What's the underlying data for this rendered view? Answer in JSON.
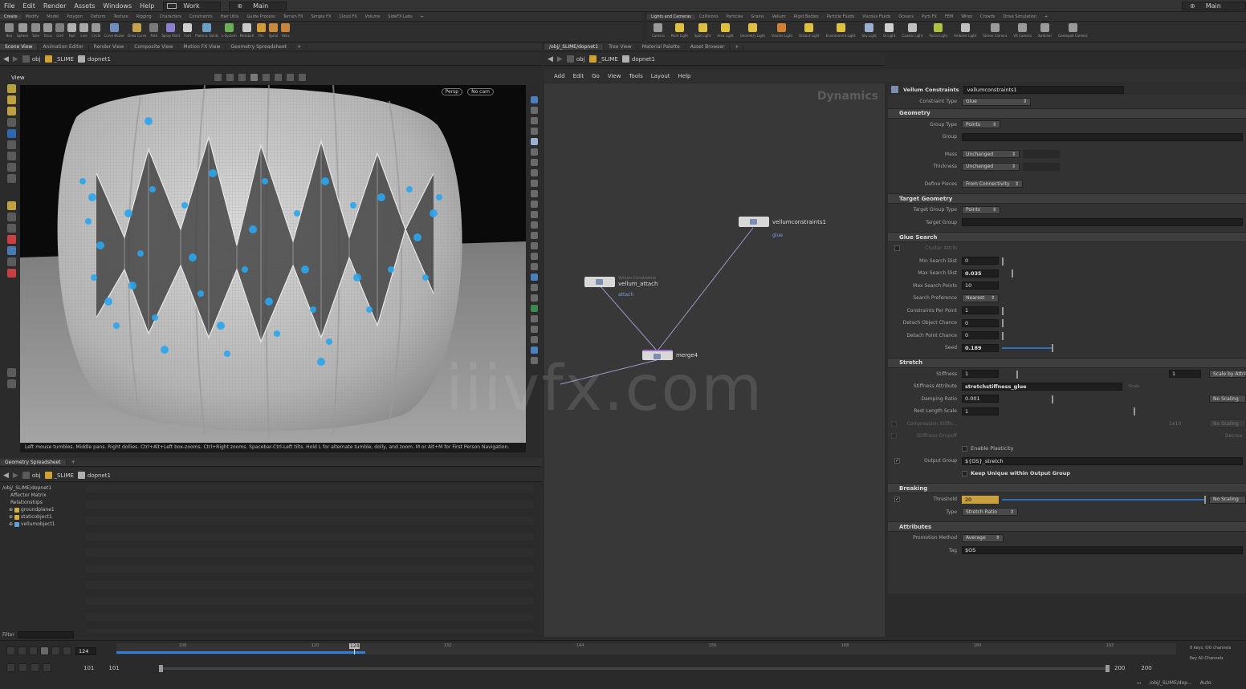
{
  "menu": {
    "items": [
      "File",
      "Edit",
      "Render",
      "Assets",
      "Windows",
      "Help"
    ],
    "desktop": "Work",
    "main": "Main",
    "right_main": "Main"
  },
  "shelf_tabs_left": [
    "Create",
    "Modify",
    "Model",
    "Polygon",
    "Deform",
    "Texture",
    "Rigging",
    "Characters",
    "Constraints",
    "Hair Utils",
    "Guide Process",
    "Terrain FX",
    "Simple FX",
    "Cloud FX",
    "Volume",
    "SideFX Labs"
  ],
  "shelf_tabs_right": [
    "Lights and Cameras",
    "Collisions",
    "Particles",
    "Grains",
    "Vellum",
    "Rigid Bodies",
    "Particle Fluids",
    "Viscous Fluids",
    "Oceans",
    "Pyro FX",
    "FEM",
    "Wires",
    "Crowds",
    "Drive Simulation"
  ],
  "tools_left": [
    {
      "label": "Box",
      "color": "#8a8a8a"
    },
    {
      "label": "Sphere",
      "color": "#9a9a9a"
    },
    {
      "label": "Tube",
      "color": "#8c8c8c"
    },
    {
      "label": "Torus",
      "color": "#999999"
    },
    {
      "label": "Grid",
      "color": "#7d7d7d"
    },
    {
      "label": "Null",
      "color": "#b0b0b0"
    },
    {
      "label": "Line",
      "color": "#a8a8a8"
    },
    {
      "label": "Circle",
      "color": "#999999"
    },
    {
      "label": "Curve Bezier",
      "color": "#6f8fc0"
    },
    {
      "label": "Draw Curve",
      "color": "#c7a24a"
    },
    {
      "label": "Path",
      "color": "#7a7a7a"
    },
    {
      "label": "Spray Paint",
      "color": "#8c7fd0"
    },
    {
      "label": "Font",
      "color": "#cfcfcf"
    },
    {
      "label": "Platonic Solids",
      "color": "#6aa0c8"
    },
    {
      "label": "L-System",
      "color": "#6cae58"
    },
    {
      "label": "Metaball",
      "color": "#c8c8c8"
    },
    {
      "label": "File",
      "color": "#d39a3a"
    },
    {
      "label": "Spiral",
      "color": "#c98a3c"
    },
    {
      "label": "Helix",
      "color": "#c7843c"
    }
  ],
  "tools_right": [
    {
      "label": "Camera",
      "color": "#9a9a9a"
    },
    {
      "label": "Point Light",
      "color": "#e0c040"
    },
    {
      "label": "Spot Light",
      "color": "#e0c040"
    },
    {
      "label": "Area Light",
      "color": "#e0c040"
    },
    {
      "label": "Geometry Light",
      "color": "#e0c040"
    },
    {
      "label": "Volume Light",
      "color": "#d08030"
    },
    {
      "label": "Distant Light",
      "color": "#e0c040"
    },
    {
      "label": "Environment Light",
      "color": "#e0c040"
    },
    {
      "label": "Sky Light",
      "color": "#9ab0d0"
    },
    {
      "label": "GI Light",
      "color": "#d0d0d0"
    },
    {
      "label": "Caustic Light",
      "color": "#c0c0c0"
    },
    {
      "label": "Portal Light",
      "color": "#b0c040"
    },
    {
      "label": "Ambient Light",
      "color": "#c0c0c0"
    },
    {
      "label": "Stereo Camera",
      "color": "#9a9a9a"
    },
    {
      "label": "VR Camera",
      "color": "#9a9a9a"
    },
    {
      "label": "Switcher",
      "color": "#9a9a9a"
    },
    {
      "label": "Gamepad Camera",
      "color": "#9a9a9a"
    }
  ],
  "left_pane": {
    "tabs": [
      "Scene View",
      "Animation Editor",
      "Render View",
      "Composite View",
      "Motion FX View",
      "Geometry Spreadsheet"
    ],
    "path": [
      "obj",
      "_SLIME",
      "dopnet1"
    ],
    "view_label": "View",
    "persp": "Persp",
    "cam": "No cam",
    "status": "Left mouse tumbles. Middle pans. Right dollies. Ctrl+Alt+Left box-zooms. Ctrl+Right zooms. Spacebar-Ctrl-Left tilts. Hold L for alternate tumble, dolly, and zoom.    M or Alt+M for First Person Navigation."
  },
  "spreadsheet": {
    "tab": "Geometry Spreadsheet",
    "path": [
      "obj",
      "_SLIME",
      "dopnet1"
    ],
    "tree": [
      {
        "label": "/obj/_SLIME/dopnet1",
        "color": "#aaaaaa"
      },
      {
        "label": "Affector Matrix",
        "color": "#aaaaaa"
      },
      {
        "label": "Relationships",
        "color": "#aaaaaa"
      },
      {
        "label": "groundplane1",
        "color": "#d0b040"
      },
      {
        "label": "staticobject1",
        "color": "#d0b040"
      },
      {
        "label": "vellumobject1",
        "color": "#5fa0e0"
      }
    ],
    "filter_label": "Filter"
  },
  "right_pane": {
    "tabs": [
      "/obj/_SLIME/dopnet1",
      "Tree View",
      "Material Palette",
      "Asset Browser"
    ],
    "path": [
      "obj",
      "_SLIME",
      "dopnet1"
    ],
    "menu": [
      "Add",
      "Edit",
      "Go",
      "View",
      "Tools",
      "Layout",
      "Help"
    ],
    "context": "Dynamics"
  },
  "nodes": {
    "vellumconstraints": {
      "name": "vellumconstraints1",
      "sub": "glue"
    },
    "attach": {
      "name": "vellum_attach",
      "comment": "Vellum Constraints",
      "sub": "attach"
    },
    "merge": {
      "name": "merge4"
    }
  },
  "params": {
    "header_type": "Vellum Constraints",
    "header_name": "vellumconstraints1",
    "constraint_type_label": "Constraint Type",
    "constraint_type": "Glue",
    "sections": {
      "geometry": "Geometry",
      "target_geometry": "Target Geometry",
      "glue_search": "Glue Search",
      "stretch": "Stretch",
      "breaking": "Breaking",
      "attributes": "Attributes"
    },
    "group_type_label": "Group Type",
    "group_type": "Points",
    "group_label": "Group",
    "mass_label": "Mass",
    "mass": "Unchanged",
    "thickness_label": "Thickness",
    "thickness": "Unchanged",
    "define_pieces_label": "Define Pieces",
    "define_pieces": "From Connectivity",
    "target_group_type_label": "Target Group Type",
    "target_group_type": "Points",
    "target_group_label": "Target Group",
    "cluster_attrib_label": "Cluster Attrib",
    "min_search_dist_label": "Min Search Dist",
    "min_search_dist": "0",
    "max_search_dist_label": "Max Search Dist",
    "max_search_dist": "0.035",
    "max_search_points_label": "Max Search Points",
    "max_search_points": "10",
    "search_pref_label": "Search Preference",
    "search_pref": "Nearest",
    "constraints_per_point_label": "Constraints Per Point",
    "constraints_per_point": "1",
    "detach_obj_label": "Detach Object Chance",
    "detach_obj": "0",
    "detach_pt_label": "Detach Point Chance",
    "detach_pt": "0",
    "seed_label": "Seed",
    "seed": "0.189",
    "stiffness_label": "Stiffness",
    "stiffness": "1",
    "stiffness_mult": "1",
    "stiffness_scale": "Scale by Attrib",
    "stiffness_attr_label": "Stiffness Attribute",
    "stiffness_attr": "stretchstiffness_glue",
    "stiffness_attr_scale": "Scale",
    "damping_label": "Damping Ratio",
    "damping": "0.001",
    "damping_scale": "No Scaling",
    "rest_length_label": "Rest Length Scale",
    "rest_length": "1",
    "compression_label": "Compression Stiffn...",
    "compression_val": "1e10",
    "compression_scale": "No Scaling",
    "stiff_dropoff_label": "Stiffness Dropoff",
    "stiff_dropoff_scale": "Decrea",
    "enable_plasticity": "Enable Plasticity",
    "output_group_label": "Output Group",
    "output_group": "${OS}_stretch",
    "keep_unique": "Keep Unique within Output Group",
    "threshold_label": "Threshold",
    "threshold": "20",
    "threshold_scale": "No Scaling",
    "type_label": "Type",
    "type": "Stretch Ratio",
    "promotion_label": "Promotion Method",
    "promotion": "Average",
    "tag_label": "Tag",
    "tag": "$OS"
  },
  "timeline": {
    "frame": "124",
    "start": "101",
    "start2": "101",
    "end": "200",
    "end2": "200",
    "ticks": [
      "108",
      "120",
      "132",
      "144",
      "156",
      "168",
      "180",
      "192"
    ],
    "keys": "0 keys, 0/0 channels",
    "key_all": "Key All Channels",
    "auto": "Auto",
    "status_path": "/obj/_SLIME/dop..."
  },
  "watermark": "iiivfx.com"
}
